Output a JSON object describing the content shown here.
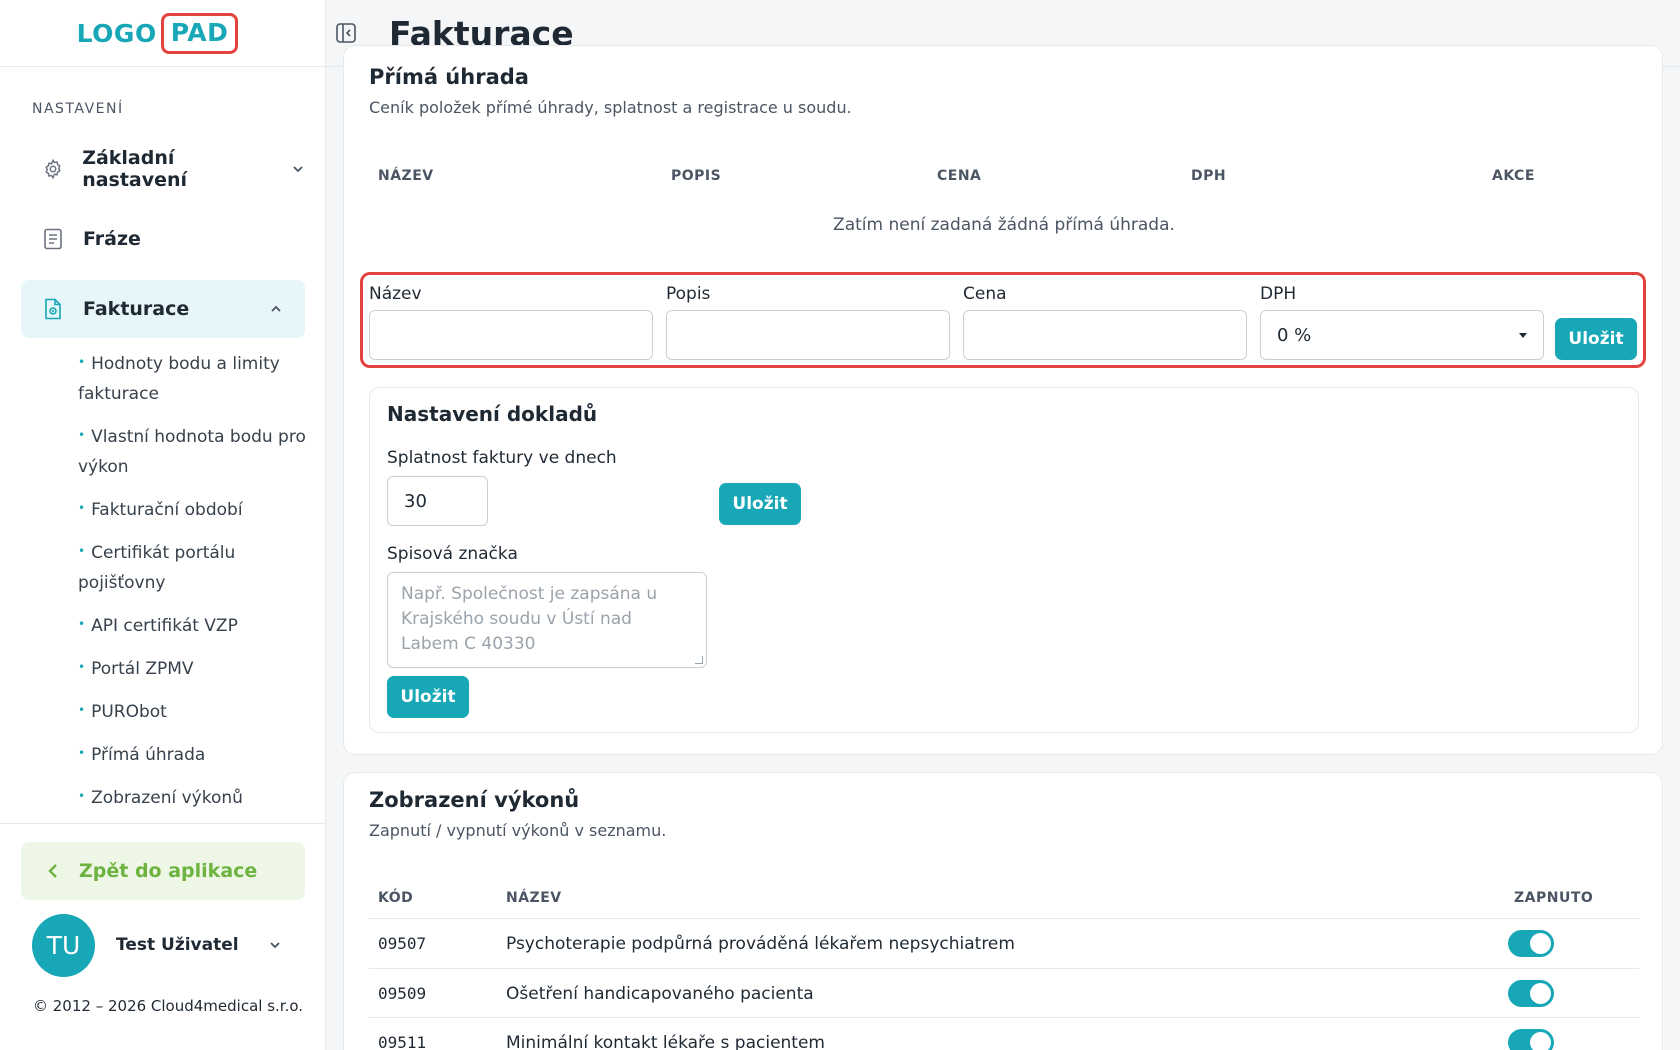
{
  "sidebar": {
    "logo": {
      "part1": "LOGO",
      "part2": "PAD"
    },
    "section_title": "NASTAVENÍ",
    "nav": [
      {
        "label": "Základní nastavení",
        "icon": "gear-icon"
      },
      {
        "label": "Fráze",
        "icon": "document-icon"
      },
      {
        "label": "Fakturace",
        "icon": "invoice-icon"
      }
    ],
    "subnav": [
      "Hodnoty bodu a limity fakturace",
      "Vlastní hodnota bodu pro výkon",
      "Fakturační období",
      "Certifikát portálu pojišťovny",
      "API certifikát VZP",
      "Portál ZPMV",
      "PURObot",
      "Přímá úhrada",
      "Zobrazení výkonů"
    ],
    "back_label": "Zpět do aplikace",
    "user": {
      "initials": "TU",
      "name": "Test Uživatel"
    },
    "copyright": "© 2012 – 2026 Cloud4medical s.r.o."
  },
  "header": {
    "title": "Fakturace"
  },
  "direct_payment": {
    "title": "Přímá úhrada",
    "subtitle": "Ceník položek přímé úhrady, splatnost a registrace u soudu.",
    "columns": [
      "NÁZEV",
      "POPIS",
      "CENA",
      "DPH",
      "AKCE"
    ],
    "empty_text": "Zatím není zadaná žádná přímá úhrada.",
    "form": {
      "name_label": "Název",
      "desc_label": "Popis",
      "price_label": "Cena",
      "vat_label": "DPH",
      "vat_value": "0 %",
      "save_label": "Uložit"
    }
  },
  "documents": {
    "title": "Nastavení dokladů",
    "due_label": "Splatnost faktury ve dnech",
    "due_value": "30",
    "save_label": "Uložit",
    "file_label": "Spisová značka",
    "file_placeholder": "Např. Společnost je zapsána u Krajského soudu v Ústí nad Labem C 40330",
    "file_save_label": "Uložit"
  },
  "procedures": {
    "title": "Zobrazení výkonů",
    "subtitle": "Zapnutí / vypnutí výkonů v seznamu.",
    "columns": {
      "code": "KÓD",
      "name": "NÁZEV",
      "enabled": "ZAPNUTO"
    },
    "rows": [
      {
        "code": "09507",
        "name": "Psychoterapie podpůrná prováděná lékařem nepsychiatrem",
        "enabled": true
      },
      {
        "code": "09509",
        "name": "Ošetření handicapovaného pacienta",
        "enabled": true
      },
      {
        "code": "09511",
        "name": "Minimální kontakt lékaře s pacientem",
        "enabled": true
      }
    ]
  }
}
